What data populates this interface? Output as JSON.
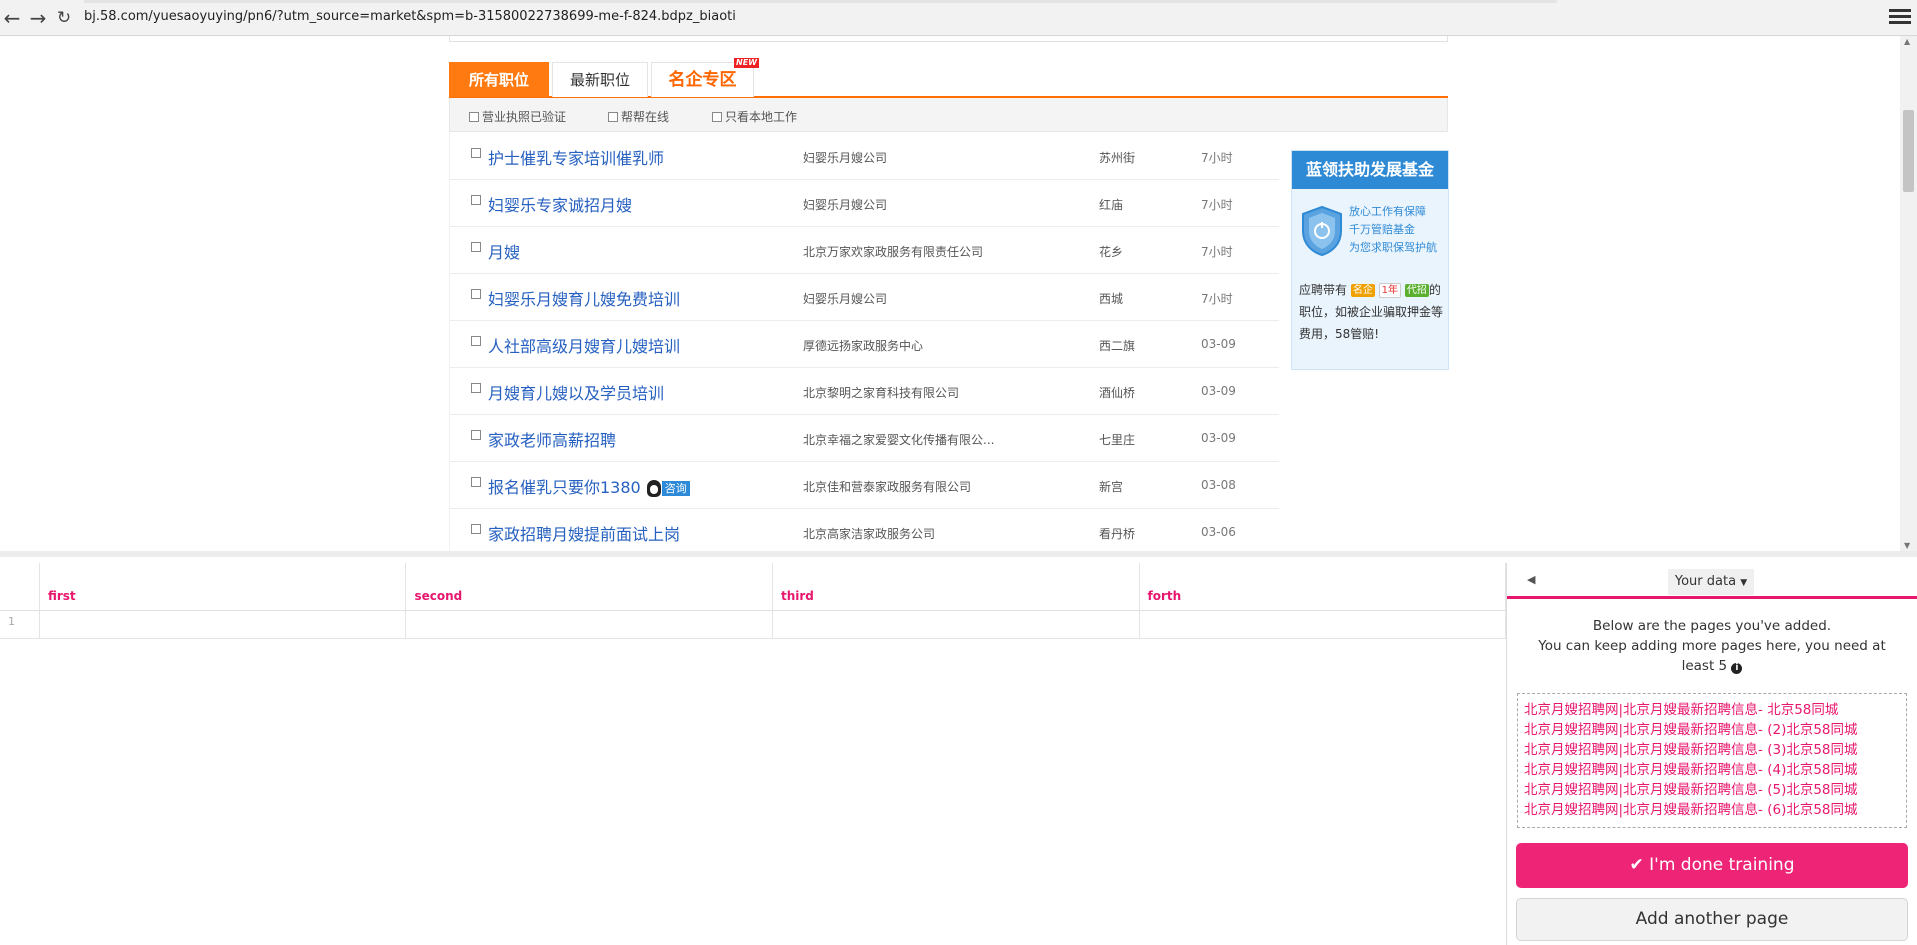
{
  "browser": {
    "url": "bj.58.com/yuesaoyuying/pn6/?utm_source=market&spm=b-31580022738699-me-f-824.bdpz_biaoti"
  },
  "tabs": [
    {
      "label": "所有职位"
    },
    {
      "label": "最新职位"
    },
    {
      "label": "名企专区",
      "badge": "NEW"
    }
  ],
  "filters": [
    "营业执照已验证",
    "帮帮在线",
    "只看本地工作"
  ],
  "jobs": [
    {
      "title": "护士催乳专家培训催乳师",
      "company": "妇婴乐月嫂公司",
      "area": "苏州街",
      "time": "7小时"
    },
    {
      "title": "妇婴乐专家诚招月嫂",
      "company": "妇婴乐月嫂公司",
      "area": "红庙",
      "time": "7小时"
    },
    {
      "title": "月嫂",
      "company": "北京万家欢家政服务有限责任公司",
      "area": "花乡",
      "time": "7小时"
    },
    {
      "title": "妇婴乐月嫂育儿嫂免费培训",
      "company": "妇婴乐月嫂公司",
      "area": "西城",
      "time": "7小时"
    },
    {
      "title": "人社部高级月嫂育儿嫂培训",
      "company": "厚德远扬家政服务中心",
      "area": "西二旗",
      "time": "03-09"
    },
    {
      "title": "月嫂育儿嫂以及学员培训",
      "company": "北京黎明之家育科技有限公司",
      "area": "酒仙桥",
      "time": "03-09"
    },
    {
      "title": "家政老师高薪招聘",
      "company": "北京幸福之家爱婴文化传播有限公...",
      "area": "七里庄",
      "time": "03-09"
    },
    {
      "title": "报名催乳只要你1380",
      "company": "北京佳和营泰家政服务有限公司",
      "area": "新宫",
      "time": "03-08",
      "qq_label": "咨询"
    },
    {
      "title": "家政招聘月嫂提前面试上岗",
      "company": "北京高家洁家政服务公司",
      "area": "看丹桥",
      "time": "03-06"
    }
  ],
  "sidebar_ad": {
    "heading": "蓝领扶助发展基金",
    "slogan": [
      "放心工作有保障",
      "千万管赔基金",
      "为您求职保驾护航"
    ],
    "desc_pre": "应聘带有",
    "tag_mq": "名企",
    "tag_yn": "1年",
    "tag_db": "代招",
    "desc_post": "的职位，如被企业骗取押金等费用，58管赔!"
  },
  "grid": {
    "columns": [
      "first",
      "second",
      "third",
      "forth"
    ],
    "row_number": "1"
  },
  "panel": {
    "back_icon": "caret-left",
    "dropdown_label": "Your data",
    "info_line1": "Below are the pages you've added.",
    "info_line2": "You can keep adding more pages here, you need at least 5",
    "pages": [
      "北京月嫂招聘网|北京月嫂最新招聘信息- 北京58同城",
      "北京月嫂招聘网|北京月嫂最新招聘信息- (2)北京58同城",
      "北京月嫂招聘网|北京月嫂最新招聘信息- (3)北京58同城",
      "北京月嫂招聘网|北京月嫂最新招聘信息- (4)北京58同城",
      "北京月嫂招聘网|北京月嫂最新招聘信息- (5)北京58同城",
      "北京月嫂招聘网|北京月嫂最新招聘信息- (6)北京58同城"
    ],
    "done_label": "I'm done training",
    "add_label": "Add another page"
  },
  "colors": {
    "accent_orange": "#ff7a11",
    "link_blue": "#2660c0",
    "ad_blue": "#2f8ad6",
    "pink": "#e8176e"
  }
}
